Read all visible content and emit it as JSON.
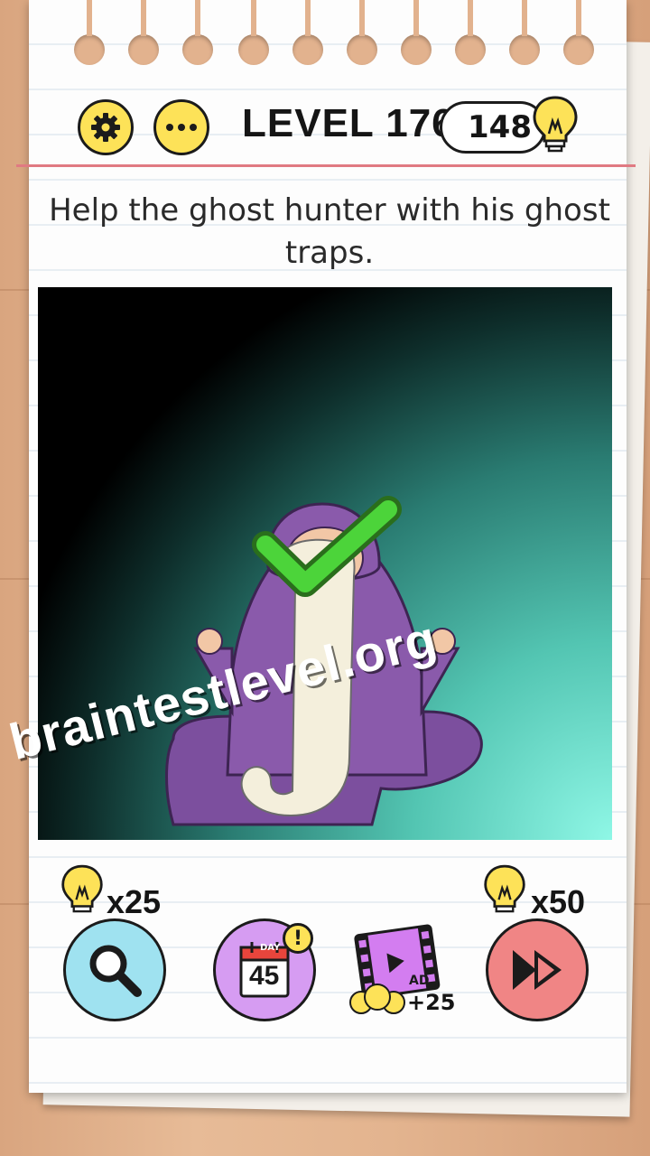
{
  "header": {
    "level_title": "LEVEL 176",
    "hint_count": "148"
  },
  "question": "Help the ghost hunter with his ghost traps.",
  "watermark": "braintestlevel.org",
  "actions": {
    "hint": {
      "cost": "x25",
      "icon": "magnifier-icon"
    },
    "daily": {
      "day_label": "DAY",
      "day_number": "45",
      "alert": "!"
    },
    "ad": {
      "label": "AD",
      "reward": "+25",
      "icon": "film-icon"
    },
    "skip": {
      "cost": "x50",
      "icon": "fast-forward-icon"
    }
  },
  "colors": {
    "accent_yellow": "#fde258",
    "hint_blue": "#9fe2f0",
    "daily_purple": "#d69cf2",
    "skip_red": "#f08585",
    "check_green": "#4cd43a"
  }
}
